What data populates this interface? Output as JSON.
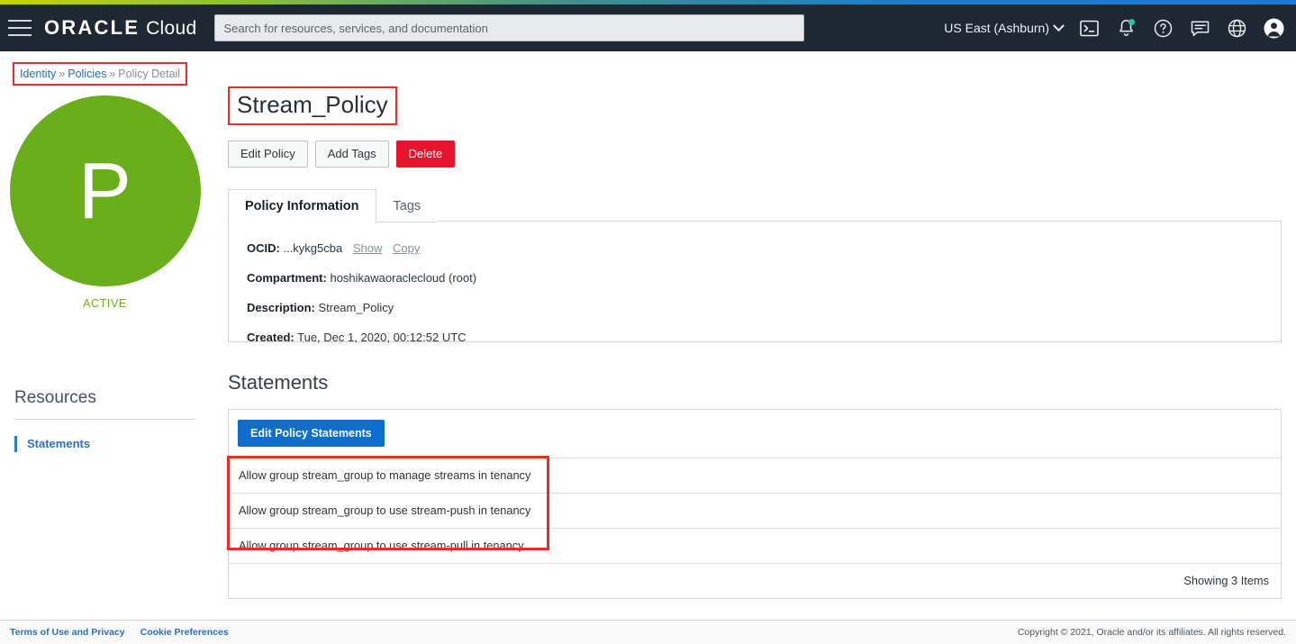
{
  "header": {
    "menu_icon": "hamburger-menu-icon",
    "brand_oracle": "ORACLE",
    "brand_cloud": "Cloud",
    "search_placeholder": "Search for resources, services, and documentation",
    "search_value": "",
    "region": "US East (Ashburn)",
    "icons": [
      {
        "name": "cloud-shell-icon",
        "label": "Cloud Shell"
      },
      {
        "name": "notifications-bell-icon",
        "label": "Notifications",
        "badge": true
      },
      {
        "name": "help-icon",
        "label": "Help"
      },
      {
        "name": "feedback-chat-icon",
        "label": "Feedback"
      },
      {
        "name": "language-globe-icon",
        "label": "Language"
      },
      {
        "name": "profile-avatar-icon",
        "label": "Profile"
      }
    ],
    "background": "#1e2833"
  },
  "breadcrumb": {
    "items": [
      {
        "label": "Identity",
        "link": true
      },
      {
        "label": "Policies",
        "link": true
      },
      {
        "label": "Policy Detail",
        "link": false
      }
    ],
    "separator": "»"
  },
  "left": {
    "avatar_letter": "P",
    "avatar_color": "#6bae1c",
    "status": "ACTIVE",
    "resources_heading": "Resources",
    "resources_items": [
      {
        "label": "Statements",
        "selected": true
      }
    ]
  },
  "main": {
    "title": "Stream_Policy",
    "actions": [
      {
        "label": "Edit Policy",
        "style": "default"
      },
      {
        "label": "Add Tags",
        "style": "default"
      },
      {
        "label": "Delete",
        "style": "danger"
      }
    ],
    "tabs": [
      {
        "label": "Policy Information",
        "active": true
      },
      {
        "label": "Tags",
        "active": false
      }
    ],
    "details": [
      {
        "key": "OCID:",
        "value": "...kykg5cba",
        "links": [
          "Show",
          "Copy"
        ]
      },
      {
        "key": "Compartment:",
        "value": "hoshikawaoraclecloud (root)"
      },
      {
        "key": "Description:",
        "value": "Stream_Policy"
      },
      {
        "key": "Created:",
        "value": "Tue, Dec 1, 2020, 00:12:52 UTC"
      }
    ],
    "section_title": "Statements",
    "table": {
      "toolbar_button": "Edit Policy Statements",
      "rows": [
        "Allow group stream_group to manage streams in tenancy",
        "Allow group stream_group to use stream-push in tenancy",
        "Allow group stream_group to use stream-pull in tenancy"
      ],
      "footer": "Showing 3 Items"
    }
  },
  "footer": {
    "links": [
      {
        "label": "Terms of Use and Privacy"
      },
      {
        "label": "Cookie Preferences"
      }
    ],
    "copyright": "Copyright © 2021, Oracle and/or its affiliates. All rights reserved."
  },
  "annotation_color": "#ee2b2b"
}
